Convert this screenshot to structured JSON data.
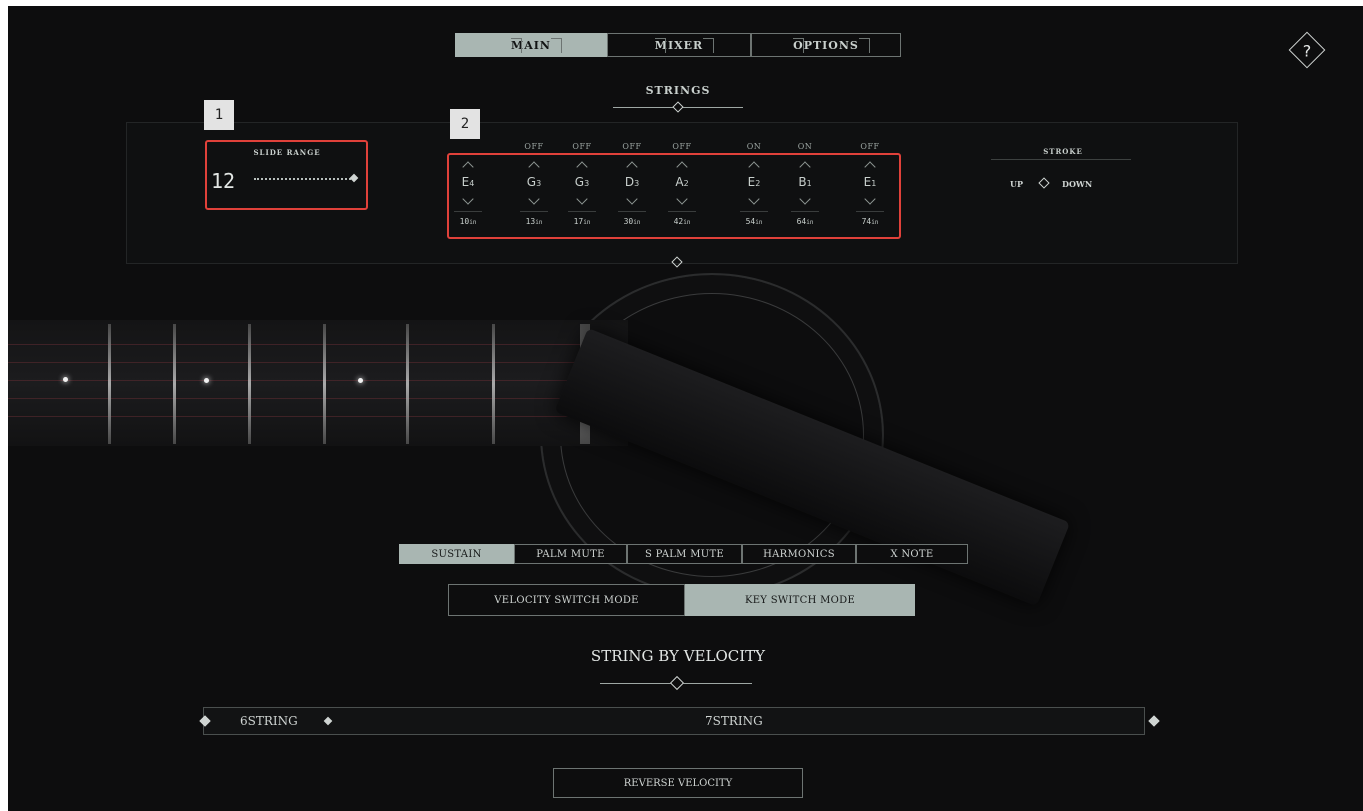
{
  "tabs": [
    {
      "label": "MAIN",
      "active": true
    },
    {
      "label": "MIXER",
      "active": false
    },
    {
      "label": "OPTIONS",
      "active": false
    }
  ],
  "help": {
    "label": "?"
  },
  "strings_section": {
    "title": "STRINGS"
  },
  "annotations": {
    "badge1": "1",
    "badge2": "2"
  },
  "slide_range": {
    "label": "SLIDE RANGE",
    "value": "12"
  },
  "strings": [
    {
      "state": "",
      "note": "E",
      "octave": "4",
      "gauge": "10",
      "unit": "in"
    },
    {
      "state": "OFF",
      "note": "G",
      "octave": "3",
      "gauge": "13",
      "unit": "in"
    },
    {
      "state": "OFF",
      "note": "G",
      "octave": "3",
      "gauge": "17",
      "unit": "in"
    },
    {
      "state": "OFF",
      "note": "D",
      "octave": "3",
      "gauge": "30",
      "unit": "in"
    },
    {
      "state": "OFF",
      "note": "A",
      "octave": "2",
      "gauge": "42",
      "unit": "in"
    },
    {
      "state": "ON",
      "note": "E",
      "octave": "2",
      "gauge": "54",
      "unit": "in"
    },
    {
      "state": "ON",
      "note": "B",
      "octave": "1",
      "gauge": "64",
      "unit": "in"
    },
    {
      "state": "OFF",
      "note": "E",
      "octave": "1",
      "gauge": "74",
      "unit": "in"
    }
  ],
  "stroke": {
    "label": "STROKE",
    "up": "UP",
    "down": "DOWN"
  },
  "articulations": [
    {
      "label": "SUSTAIN",
      "active": true
    },
    {
      "label": "PALM MUTE",
      "active": false
    },
    {
      "label": "S PALM MUTE",
      "active": false
    },
    {
      "label": "HARMONICS",
      "active": false
    },
    {
      "label": "X NOTE",
      "active": false
    }
  ],
  "modes": [
    {
      "label": "VELOCITY SWITCH MODE",
      "active": false
    },
    {
      "label": "KEY SWITCH MODE",
      "active": true
    }
  ],
  "string_by_velocity": {
    "title": "STRING BY VELOCITY",
    "left": "6STRING",
    "right": "7STRING"
  },
  "reverse_velocity": {
    "label": "REVERSE VELOCITY"
  },
  "colors": {
    "accent": "#a9b6b2",
    "annotation": "#e0413a",
    "background": "#0d0d0e"
  }
}
